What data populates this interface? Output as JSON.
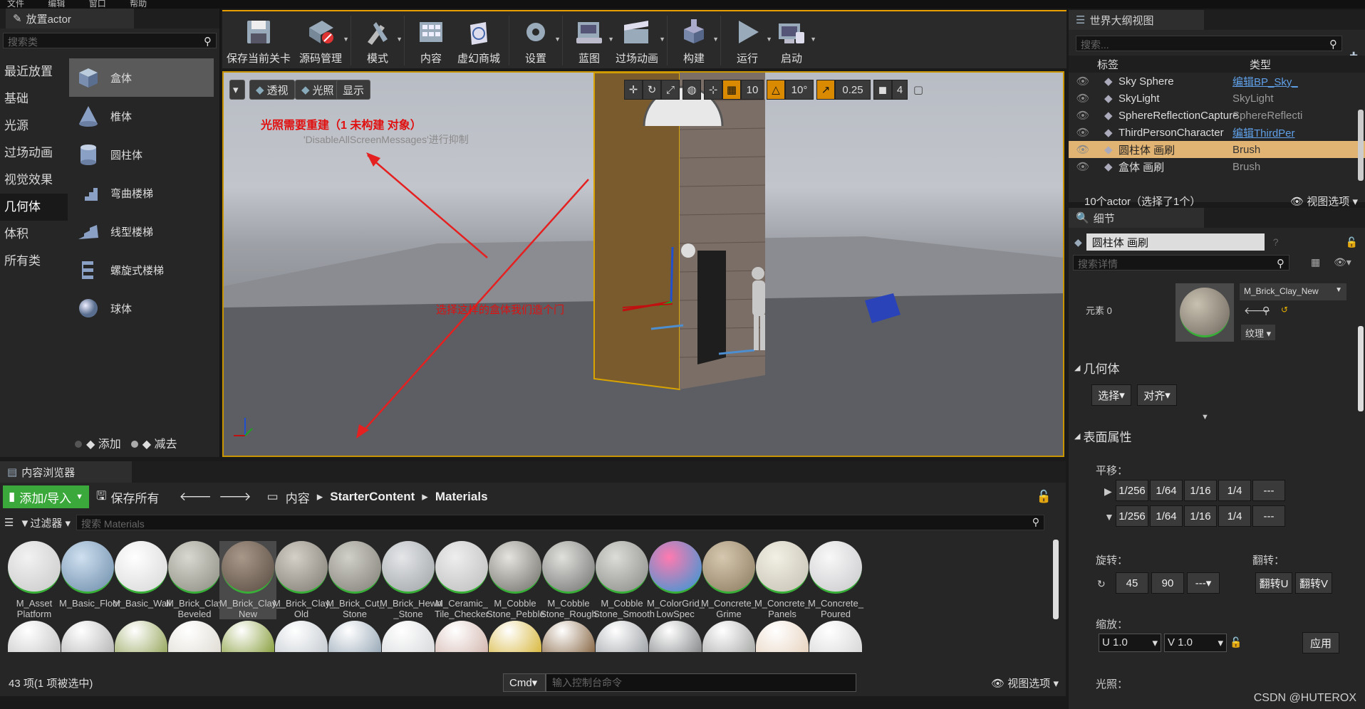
{
  "menu": [
    "文件",
    "编辑",
    "窗口",
    "帮助"
  ],
  "place": {
    "tab_title": "放置actor",
    "search_placeholder": "搜索类",
    "categories": [
      "最近放置",
      "基础",
      "光源",
      "过场动画",
      "视觉效果",
      "几何体",
      "体积",
      "所有类"
    ],
    "selected_category": "几何体",
    "items": [
      "盒体",
      "椎体",
      "圆柱体",
      "弯曲楼梯",
      "线型楼梯",
      "螺旋式楼梯",
      "球体"
    ],
    "selected_item": "盒体",
    "add_label": "添加",
    "subtract_label": "减去"
  },
  "toolbar": {
    "buttons": [
      {
        "label": "保存当前关卡",
        "icon": "save-icon"
      },
      {
        "label": "源码管理",
        "icon": "source-control-icon"
      },
      {
        "label": "模式",
        "icon": "modes-icon"
      },
      {
        "label": "内容",
        "icon": "content-icon"
      },
      {
        "label": "虚幻商城",
        "icon": "marketplace-icon"
      },
      {
        "label": "设置",
        "icon": "settings-icon"
      },
      {
        "label": "蓝图",
        "icon": "blueprint-icon"
      },
      {
        "label": "过场动画",
        "icon": "cinematics-icon"
      },
      {
        "label": "构建",
        "icon": "build-icon"
      },
      {
        "label": "运行",
        "icon": "play-icon"
      },
      {
        "label": "启动",
        "icon": "launch-icon"
      }
    ]
  },
  "viewport": {
    "perspective": "透视",
    "lit": "光照",
    "show": "显示",
    "grid_snap": "10",
    "rot_snap": "10°",
    "scale_snap": "0.25",
    "cam_speed": "4",
    "warning": "光照需要重建（1 未构建 对象）",
    "warning_sub": "'DisableAllScreenMessages'进行抑制",
    "annotation": "选择这样的盒体我们造个门"
  },
  "content_browser": {
    "tab_title": "内容浏览器",
    "add_import": "添加/导入",
    "save_all": "保存所有",
    "breadcrumb": [
      "内容",
      "StarterContent",
      "Materials"
    ],
    "filters": "过滤器",
    "search_placeholder": "搜索 Materials",
    "assets": [
      "M_Asset Platform",
      "M_Basic_Floor",
      "M_Basic_Wall",
      "M_Brick_Clay_ Beveled",
      "M_Brick_Clay_ New",
      "M_Brick_Clay_ Old",
      "M_Brick_Cut_ Stone",
      "M_Brick_Hewn _Stone",
      "M_Ceramic_ Tile_Checker",
      "M_Cobble Stone_Pebble",
      "M_Cobble Stone_Rough",
      "M_Cobble Stone_Smooth",
      "M_ColorGrid_ LowSpec",
      "M_Concrete_ Grime",
      "M_Concrete_ Panels",
      "M_Concrete_ Poured"
    ],
    "status": "43 项(1 项被选中)",
    "cmd_label": "Cmd",
    "cmd_placeholder": "输入控制台命令",
    "view_options": "视图选项"
  },
  "outliner": {
    "tab_title": "世界大纲视图",
    "search_placeholder": "搜索...",
    "col_label": "标签",
    "col_type": "类型",
    "rows": [
      {
        "name": "Sky Sphere",
        "type": "编辑BP_Sky_",
        "link": true
      },
      {
        "name": "SkyLight",
        "type": "SkyLight",
        "link": false
      },
      {
        "name": "SphereReflectionCapture",
        "type": "SphereReflecti",
        "link": false
      },
      {
        "name": "ThirdPersonCharacter",
        "type": "编辑ThirdPer",
        "link": true
      },
      {
        "name": "圆柱体 画刷",
        "type": "Brush",
        "link": false
      },
      {
        "name": "盒体 画刷",
        "type": "Brush",
        "link": false
      }
    ],
    "count": "10个actor（选择了1个）",
    "view_options": "视图选项"
  },
  "details": {
    "tab_title": "细节",
    "object_name": "圆柱体 画刷",
    "search_placeholder": "搜索详情",
    "element": "元素 0",
    "material": "M_Brick_Clay_New",
    "texture": "纹理",
    "geometry": "几何体",
    "select": "选择",
    "align": "对齐",
    "surface": "表面属性",
    "pan": "平移：",
    "pan_values": [
      "1/256",
      "1/64",
      "1/16",
      "1/4",
      "---"
    ],
    "rotate": "旋转：",
    "rotate_values": [
      "45",
      "90",
      "---"
    ],
    "flip": "翻转：",
    "flip_u": "翻转U",
    "flip_v": "翻转V",
    "scale": "缩放：",
    "u_value": "U  1.0",
    "v_value": "V  1.0",
    "apply": "应用",
    "lighting": "光照："
  },
  "watermark": "CSDN @HUTEROX"
}
